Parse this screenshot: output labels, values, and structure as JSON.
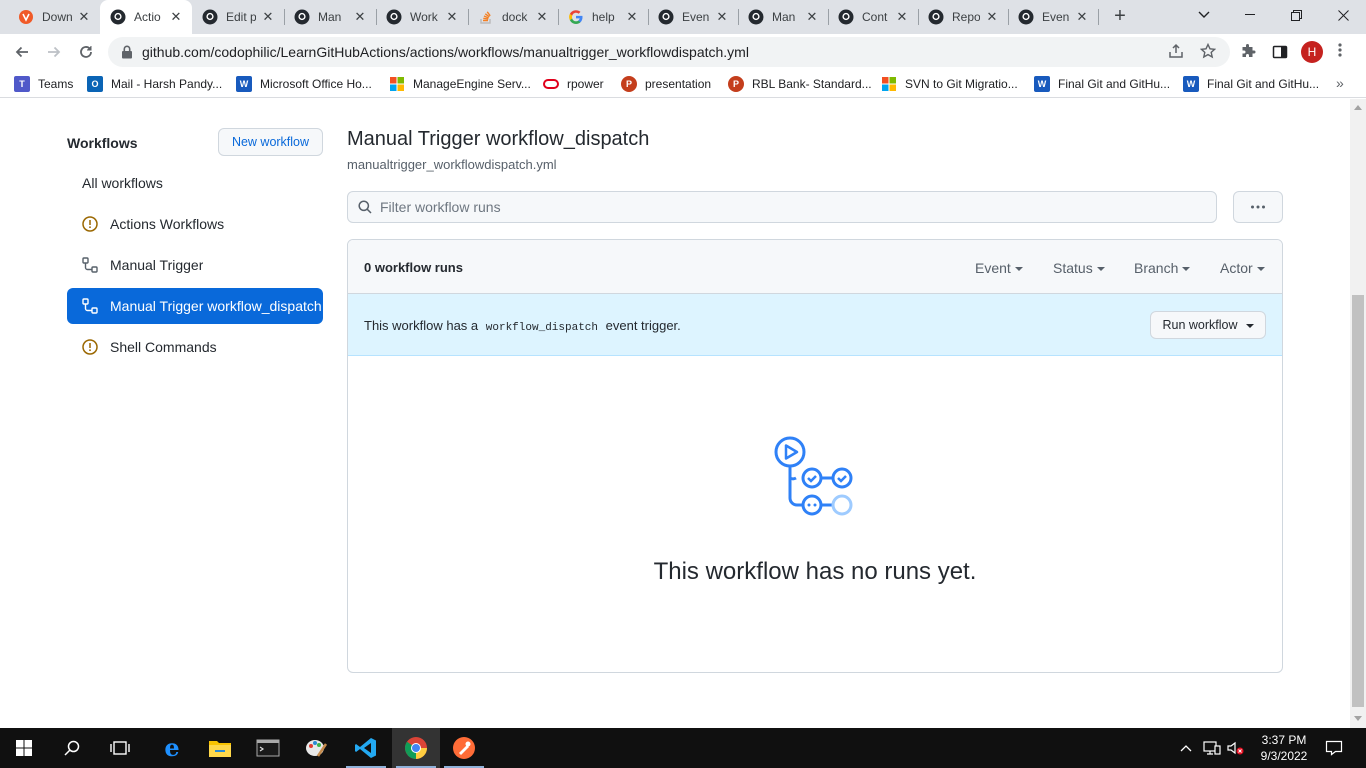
{
  "browser": {
    "tabs": [
      {
        "title": "Down",
        "icon": "brave-icon",
        "active": false
      },
      {
        "title": "Actio",
        "icon": "github-icon",
        "active": true
      },
      {
        "title": "Edit p",
        "icon": "github-icon",
        "active": false
      },
      {
        "title": "Man",
        "icon": "github-icon",
        "active": false
      },
      {
        "title": "Work",
        "icon": "github-icon",
        "active": false
      },
      {
        "title": "dock",
        "icon": "stackoverflow-icon",
        "active": false
      },
      {
        "title": "help",
        "icon": "google-icon",
        "active": false
      },
      {
        "title": "Even",
        "icon": "github-icon",
        "active": false
      },
      {
        "title": "Man",
        "icon": "github-icon",
        "active": false
      },
      {
        "title": "Cont",
        "icon": "github-icon",
        "active": false
      },
      {
        "title": "Repo",
        "icon": "github-icon",
        "active": false
      },
      {
        "title": "Even",
        "icon": "github-icon",
        "active": false
      }
    ],
    "url": "github.com/codophilic/LearnGitHubActions/actions/workflows/manualtrigger_workflowdispatch.yml",
    "profile_initial": "H",
    "bookmarks": [
      {
        "label": "Teams",
        "icon": "teams-icon",
        "color": "#5059c9"
      },
      {
        "label": "Mail - Harsh Pandy...",
        "icon": "outlook-icon",
        "color": "#0a64b5"
      },
      {
        "label": "Microsoft Office Ho...",
        "icon": "word-icon",
        "color": "#185abd"
      },
      {
        "label": "ManageEngine Serv...",
        "icon": "microsoft-icon",
        "color": "#f25022"
      },
      {
        "label": "rpower",
        "icon": "oracle-icon",
        "color": "#e0001b"
      },
      {
        "label": "presentation",
        "icon": "powerpoint-icon",
        "color": "#c43e1c"
      },
      {
        "label": "RBL Bank- Standard...",
        "icon": "powerpoint-icon",
        "color": "#c43e1c"
      },
      {
        "label": "SVN to Git Migratio...",
        "icon": "microsoft-icon",
        "color": "#f25022"
      },
      {
        "label": "Final Git and GitHu...",
        "icon": "word-icon",
        "color": "#185abd"
      },
      {
        "label": "Final Git and GitHu...",
        "icon": "word-icon",
        "color": "#185abd"
      }
    ]
  },
  "sidebar": {
    "title": "Workflows",
    "new_workflow_label": "New workflow",
    "items": [
      {
        "label": "All workflows",
        "icon": "",
        "active": false
      },
      {
        "label": "Actions Workflows",
        "icon": "alert-icon",
        "active": false
      },
      {
        "label": "Manual Trigger",
        "icon": "workflow-icon",
        "active": false
      },
      {
        "label": "Manual Trigger workflow_dispatch",
        "icon": "workflow-icon",
        "active": true
      },
      {
        "label": "Shell Commands",
        "icon": "alert-icon",
        "active": false
      }
    ]
  },
  "main": {
    "title": "Manual Trigger workflow_dispatch",
    "filename": "manualtrigger_workflowdispatch.yml",
    "filter_placeholder": "Filter workflow runs",
    "runs_count": "0 workflow runs",
    "filters": [
      "Event",
      "Status",
      "Branch",
      "Actor"
    ],
    "banner": {
      "prefix": "This workflow has a",
      "code": "workflow_dispatch",
      "suffix": "event trigger."
    },
    "run_workflow_label": "Run workflow",
    "empty_message": "This workflow has no runs yet."
  },
  "taskbar": {
    "time": "3:37 PM",
    "date": "9/3/2022",
    "apps": [
      "start-icon",
      "search-icon",
      "task-view-icon",
      "edge-icon",
      "file-explorer-icon",
      "terminal-icon",
      "paint-icon",
      "vscode-icon",
      "chrome-icon",
      "postman-icon"
    ]
  },
  "colors": {
    "accent": "#0969da",
    "banner_bg": "#ddf4ff",
    "alert": "#9a6700"
  }
}
